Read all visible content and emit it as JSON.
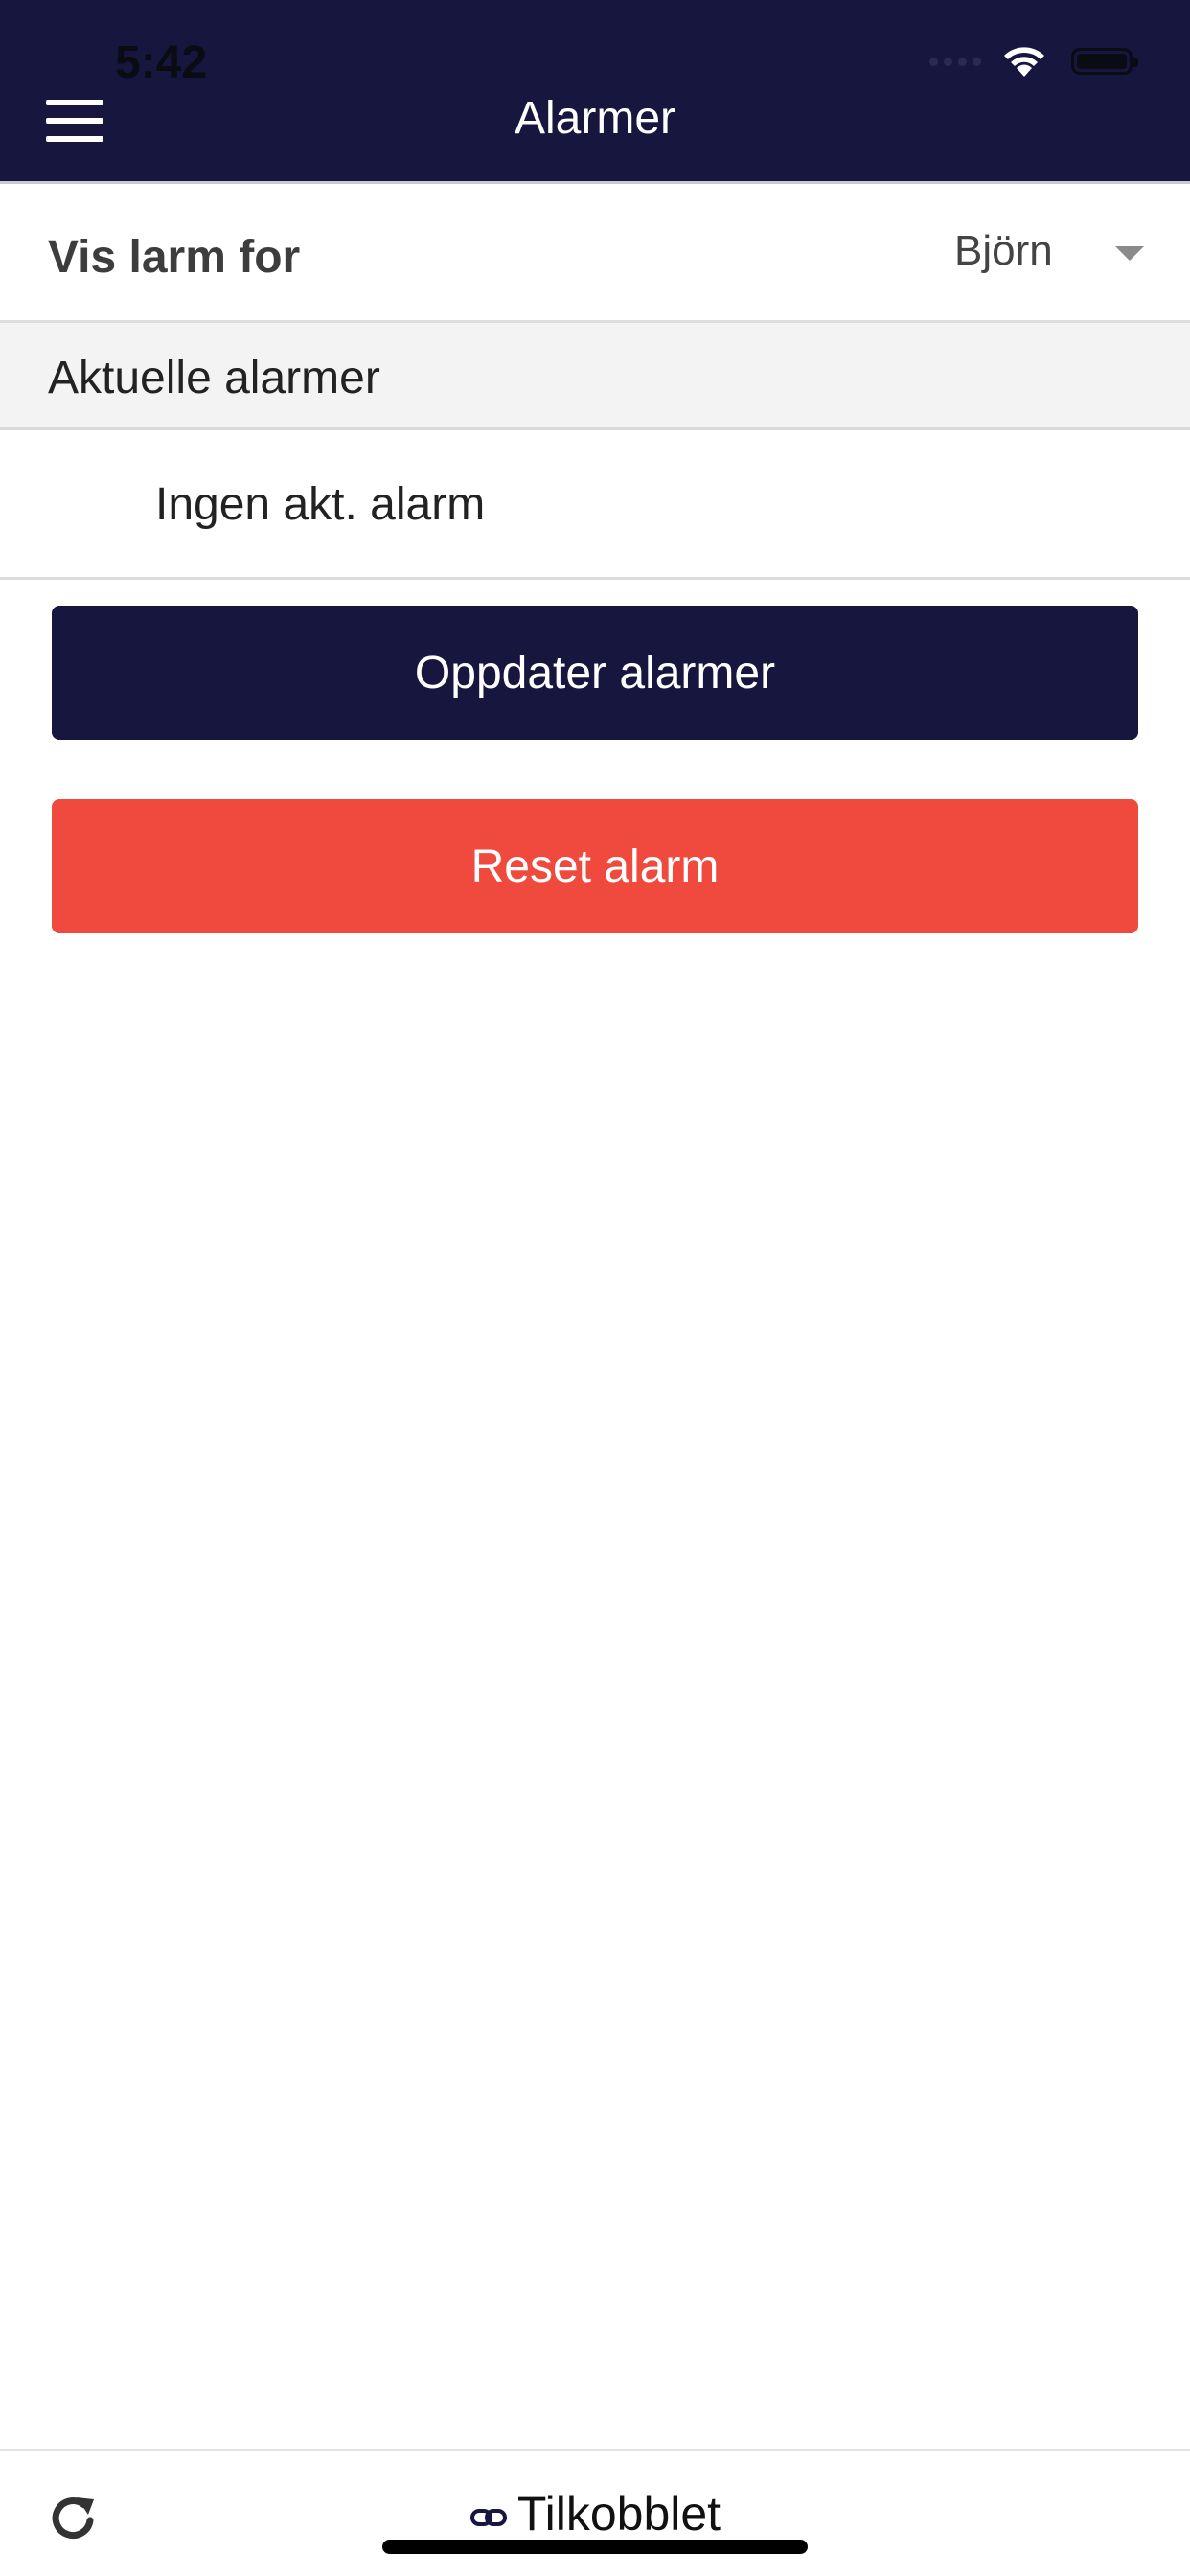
{
  "status_bar": {
    "time": "5:42"
  },
  "header": {
    "title": "Alarmer"
  },
  "filter": {
    "label": "Vis larm for",
    "selected": "Björn"
  },
  "section": {
    "title": "Aktuelle alarmer"
  },
  "alarms": {
    "empty_text": "Ingen akt. alarm"
  },
  "buttons": {
    "update_label": "Oppdater alarmer",
    "reset_label": "Reset alarm"
  },
  "footer": {
    "connection_status": "Tilkobblet"
  },
  "colors": {
    "primary": "#16163f",
    "danger": "#ef4a3d",
    "background": "#ffffff"
  }
}
